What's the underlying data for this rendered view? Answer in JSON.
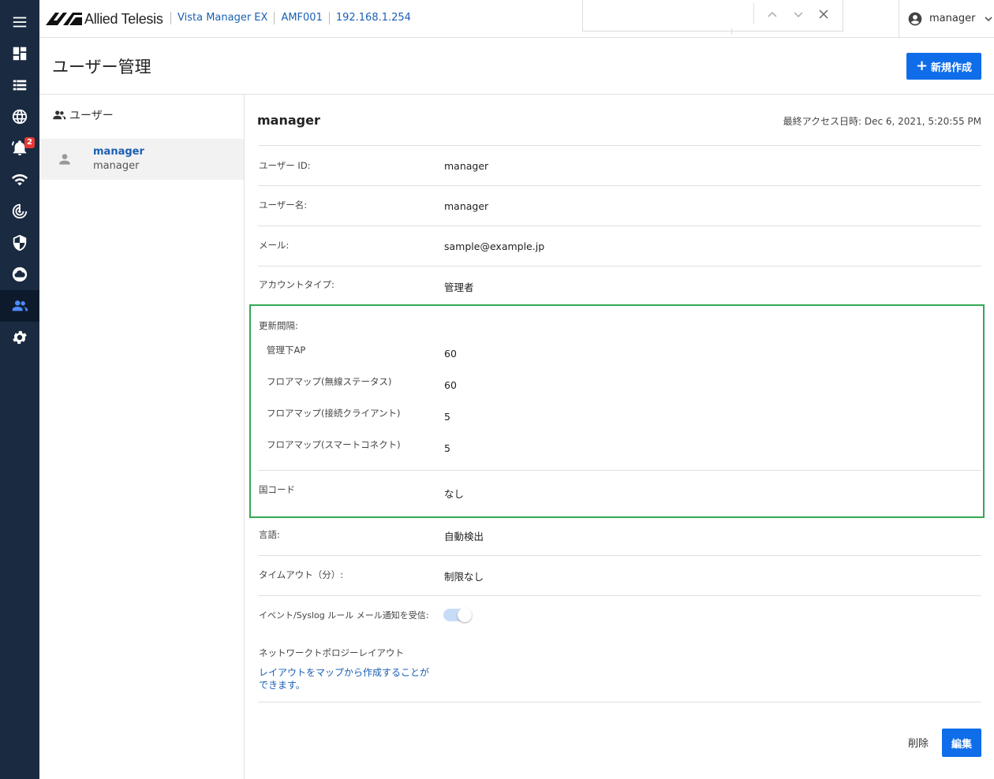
{
  "header": {
    "logo_text": "Allied Telesis",
    "breadcrumbs": [
      "Vista Manager EX",
      "AMF001",
      "192.168.1.254"
    ],
    "user_name": "manager"
  },
  "nav": {
    "notification_count": "2",
    "icons": [
      "menu-icon",
      "dashboard-icon",
      "list-icon",
      "globe-icon",
      "bell-icon",
      "wifi-icon",
      "radar-icon",
      "shield-icon",
      "cloud-icon",
      "users-icon",
      "gear-icon"
    ]
  },
  "page": {
    "title": "ユーザー管理",
    "new_button": "新規作成"
  },
  "list": {
    "heading": "ユーザー",
    "items": [
      {
        "title": "manager",
        "subtitle": "manager"
      }
    ]
  },
  "detail": {
    "name": "manager",
    "last_access": "最終アクセス日時: Dec 6, 2021, 5:20:55 PM",
    "user_id_label": "ユーザー ID:",
    "user_id": "manager",
    "username_label": "ユーザー名:",
    "username": "manager",
    "email_label": "メール:",
    "email": "sample@example.jp",
    "account_type_label": "アカウントタイプ:",
    "account_type": "管理者",
    "refresh_label": "更新間隔:",
    "refresh": [
      {
        "label": "管理下AP",
        "value": "60"
      },
      {
        "label": "フロアマップ(無線ステータス)",
        "value": "60"
      },
      {
        "label": "フロアマップ(接続クライアント)",
        "value": "5"
      },
      {
        "label": "フロアマップ(スマートコネクト)",
        "value": "5"
      }
    ],
    "country_label": "国コード",
    "country": "なし",
    "language_label": "言語:",
    "language": "自動検出",
    "timeout_label": "タイムアウト（分）:",
    "timeout": "制限なし",
    "event_label": "イベント/Syslog ルール メール通知を受信:",
    "event_enabled": true,
    "topology_label": "ネットワークトポロジーレイアウト",
    "topology_link": "レイアウトをマップから作成することができます。",
    "delete_button": "削除",
    "edit_button": "編集"
  },
  "colors": {
    "rail": "#1a2a40",
    "primary": "#0f6dea",
    "highlight_border": "#33a853"
  }
}
